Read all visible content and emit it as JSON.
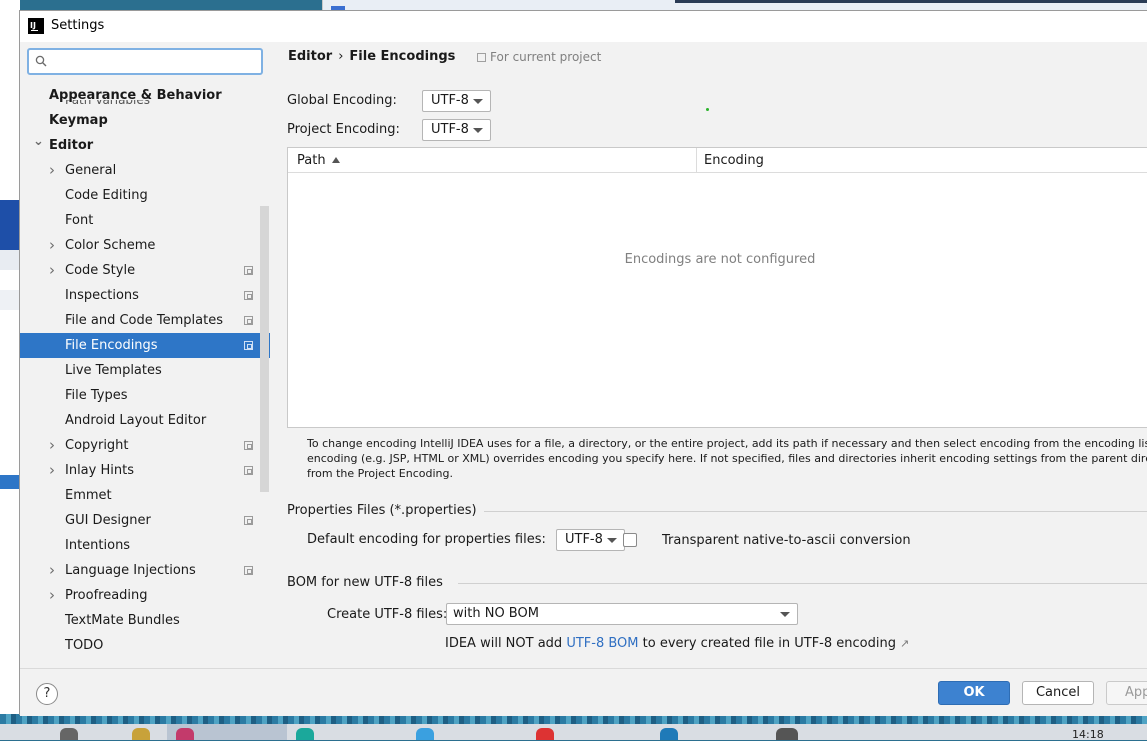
{
  "window": {
    "title": "Settings"
  },
  "search": {
    "placeholder": ""
  },
  "sidebar": {
    "cut_item": "Path Variables",
    "items": [
      {
        "label": "Appearance & Behavior",
        "bold": true,
        "indent": 0,
        "chevron": "",
        "project_icon": false
      },
      {
        "label": "Keymap",
        "bold": true,
        "indent": 0,
        "chevron": "",
        "project_icon": false
      },
      {
        "label": "Editor",
        "bold": true,
        "indent": 0,
        "chevron": "down",
        "project_icon": false
      },
      {
        "label": "General",
        "indent": 1,
        "chevron": "right",
        "project_icon": false
      },
      {
        "label": "Code Editing",
        "indent": 1,
        "chevron": "",
        "project_icon": false
      },
      {
        "label": "Font",
        "indent": 1,
        "chevron": "",
        "project_icon": false
      },
      {
        "label": "Color Scheme",
        "indent": 1,
        "chevron": "right",
        "project_icon": false
      },
      {
        "label": "Code Style",
        "indent": 1,
        "chevron": "right",
        "project_icon": true
      },
      {
        "label": "Inspections",
        "indent": 1,
        "chevron": "",
        "project_icon": true
      },
      {
        "label": "File and Code Templates",
        "indent": 1,
        "chevron": "",
        "project_icon": true
      },
      {
        "label": "File Encodings",
        "indent": 1,
        "chevron": "",
        "project_icon": true,
        "selected": true
      },
      {
        "label": "Live Templates",
        "indent": 1,
        "chevron": "",
        "project_icon": false
      },
      {
        "label": "File Types",
        "indent": 1,
        "chevron": "",
        "project_icon": false
      },
      {
        "label": "Android Layout Editor",
        "indent": 1,
        "chevron": "",
        "project_icon": false
      },
      {
        "label": "Copyright",
        "indent": 1,
        "chevron": "right",
        "project_icon": true
      },
      {
        "label": "Inlay Hints",
        "indent": 1,
        "chevron": "right",
        "project_icon": true
      },
      {
        "label": "Emmet",
        "indent": 1,
        "chevron": "",
        "project_icon": false
      },
      {
        "label": "GUI Designer",
        "indent": 1,
        "chevron": "",
        "project_icon": true
      },
      {
        "label": "Intentions",
        "indent": 1,
        "chevron": "",
        "project_icon": false
      },
      {
        "label": "Language Injections",
        "indent": 1,
        "chevron": "right",
        "project_icon": true
      },
      {
        "label": "Proofreading",
        "indent": 1,
        "chevron": "right",
        "project_icon": false
      },
      {
        "label": "TextMate Bundles",
        "indent": 1,
        "chevron": "",
        "project_icon": false
      },
      {
        "label": "TODO",
        "indent": 1,
        "chevron": "",
        "project_icon": false
      }
    ]
  },
  "header": {
    "breadcrumb_parent": "Editor",
    "breadcrumb_separator": "›",
    "breadcrumb_current": "File Encodings",
    "scope_note": "For current project"
  },
  "encodings": {
    "global_label": "Global Encoding:",
    "global_value": "UTF-8",
    "project_label": "Project Encoding:",
    "project_value": "UTF-8"
  },
  "table": {
    "columns": [
      "Path",
      "Encoding"
    ],
    "empty_text": "Encodings are not configured"
  },
  "help_text": [
    "To change encoding IntelliJ IDEA uses for a file, a directory, or the entire project, add its path if necessary and then select encoding from the encoding list. Built-in",
    "encoding (e.g. JSP, HTML or XML) overrides encoding you specify here. If not specified, files and directories inherit encoding settings from the parent directory or",
    "from the Project Encoding."
  ],
  "properties": {
    "group_title": "Properties Files (*.properties)",
    "default_label": "Default encoding for properties files:",
    "default_value": "UTF-8",
    "transparent_label": "Transparent native-to-ascii conversion",
    "transparent_checked": false
  },
  "bom": {
    "group_title": "BOM for new UTF-8 files",
    "create_label": "Create UTF-8 files:",
    "create_value": "with NO BOM",
    "note_prefix": "IDEA will NOT add",
    "note_link": "UTF-8 BOM",
    "note_suffix": "to every created file in UTF-8 encoding"
  },
  "footer": {
    "help": "?",
    "ok": "OK",
    "cancel": "Cancel",
    "apply": "Apply"
  },
  "taskbar": {
    "clock": "14:18"
  },
  "colors": {
    "selection": "#2e76c7",
    "ok_button": "#3d82d0",
    "link": "#2f6fc2"
  }
}
